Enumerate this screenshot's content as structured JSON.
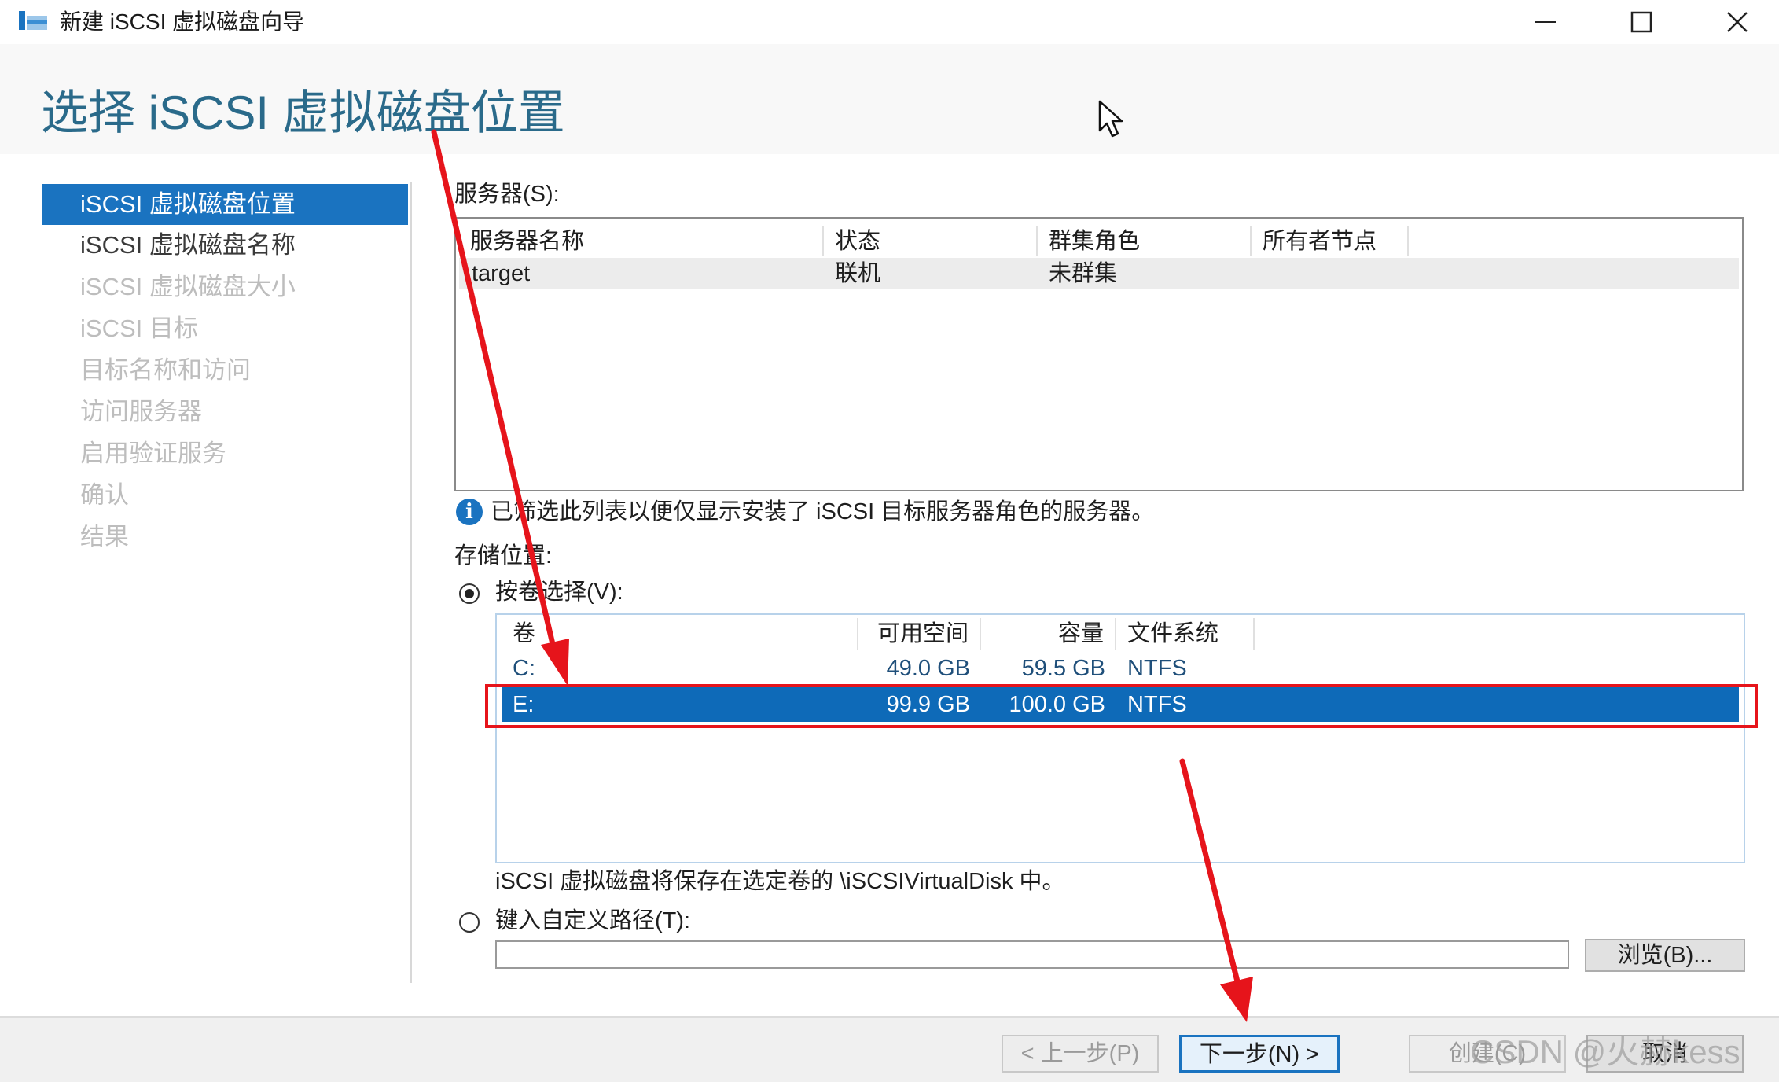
{
  "window": {
    "title": "新建 iSCSI 虚拟磁盘向导",
    "controls": [
      "minimize-icon",
      "maximize-icon",
      "close-icon"
    ]
  },
  "page": {
    "title": "选择 iSCSI 虚拟磁盘位置"
  },
  "steps": [
    {
      "label": "iSCSI 虚拟磁盘位置",
      "state": "active"
    },
    {
      "label": "iSCSI 虚拟磁盘名称",
      "state": "enabled"
    },
    {
      "label": "iSCSI 虚拟磁盘大小",
      "state": "disabled"
    },
    {
      "label": "iSCSI 目标",
      "state": "disabled"
    },
    {
      "label": "目标名称和访问",
      "state": "disabled"
    },
    {
      "label": "访问服务器",
      "state": "disabled"
    },
    {
      "label": "启用验证服务",
      "state": "disabled"
    },
    {
      "label": "确认",
      "state": "disabled"
    },
    {
      "label": "结果",
      "state": "disabled"
    }
  ],
  "servers": {
    "label": "服务器(S):",
    "columns": [
      "服务器名称",
      "状态",
      "群集角色",
      "所有者节点"
    ],
    "rows": [
      {
        "name": "target",
        "status": "联机",
        "cluster_role": "未群集",
        "owner_node": ""
      }
    ]
  },
  "info_message": "已筛选此列表以便仅显示安装了 iSCSI 目标服务器角色的服务器。",
  "storage": {
    "label": "存储位置:",
    "by_volume_label": "按卷选择(V):",
    "by_volume_checked": true,
    "volumes": {
      "columns": [
        "卷",
        "可用空间",
        "容量",
        "文件系统"
      ],
      "rows": [
        {
          "volume": "C:",
          "free": "49.0 GB",
          "capacity": "59.5 GB",
          "fs": "NTFS",
          "selected": false
        },
        {
          "volume": "E:",
          "free": "99.9 GB",
          "capacity": "100.0 GB",
          "fs": "NTFS",
          "selected": true
        }
      ]
    },
    "volume_note": "iSCSI 虚拟磁盘将保存在选定卷的 \\iSCSIVirtualDisk 中。",
    "custom_path_label": "键入自定义路径(T):",
    "custom_path_checked": false,
    "custom_path_value": "",
    "browse_label": "浏览(B)..."
  },
  "footer": {
    "prev_label": "< 上一步(P)",
    "next_label": "下一步(N) >",
    "create_label": "创建(C)",
    "cancel_label": "取消"
  },
  "annotations": {
    "arrow_color": "#e6141b",
    "highlight_color": "#e6141b",
    "watermark": "CSDN @火赫kess"
  },
  "colors": {
    "accent": "#1a73c0",
    "title": "#2a6a8a",
    "selection": "#0e6ab8"
  }
}
